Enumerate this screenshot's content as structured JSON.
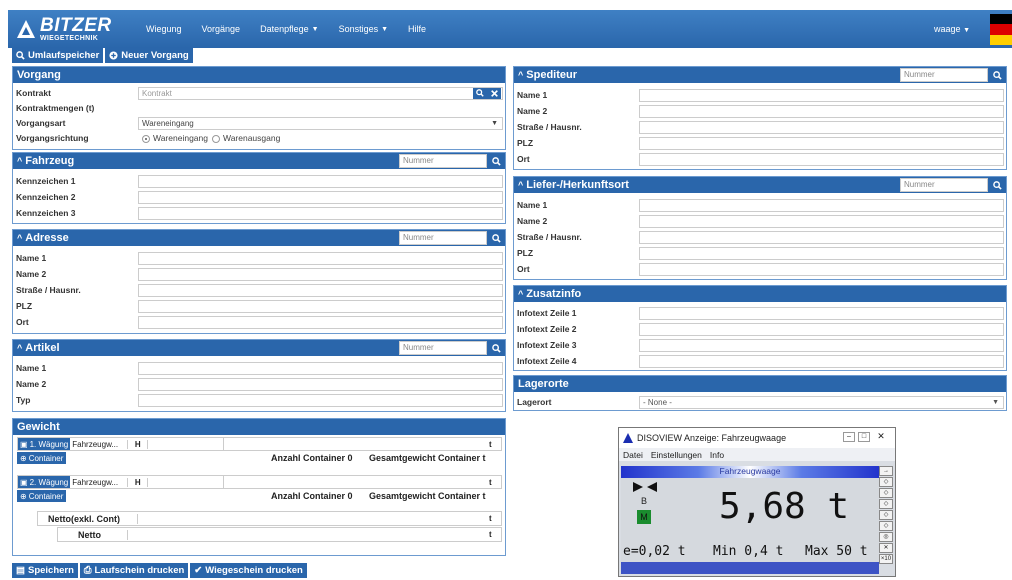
{
  "brand": {
    "name": "BITZER",
    "sub": "WIEGETECHNIK"
  },
  "nav": [
    "Wiegung",
    "Vorgänge",
    "Datenpflege",
    "Sonstiges",
    "Hilfe"
  ],
  "user": "waage",
  "toolbar": {
    "umlauf": "Umlaufspeicher",
    "neu": "Neuer Vorgang"
  },
  "vorgang": {
    "title": "Vorgang",
    "kontrakt_label": "Kontrakt",
    "kontrakt_placeholder": "Kontrakt",
    "mengen_label": "Kontraktmengen (t)",
    "art_label": "Vorgangsart",
    "art_value": "Wareneingang",
    "richtung_label": "Vorgangsrichtung",
    "richtung_opt1": "Wareneingang",
    "richtung_opt2": "Warenausgang"
  },
  "fahrzeug": {
    "title": "Fahrzeug",
    "placeholder": "Nummer",
    "fields": [
      "Kennzeichen 1",
      "Kennzeichen 2",
      "Kennzeichen 3"
    ]
  },
  "adresse": {
    "title": "Adresse",
    "placeholder": "Nummer",
    "fields": [
      "Name 1",
      "Name 2",
      "Straße / Hausnr.",
      "PLZ",
      "Ort"
    ]
  },
  "artikel": {
    "title": "Artikel",
    "placeholder": "Nummer",
    "fields": [
      "Name 1",
      "Name 2",
      "Typ"
    ]
  },
  "gewicht": {
    "title": "Gewicht",
    "w1": "1. Wägung",
    "w2": "2. Wägung",
    "scale": "Fahrzeugw...",
    "h": "H",
    "unit": "t",
    "container": "Container",
    "anzahl": "Anzahl Container 0",
    "gesamt": "Gesamtgewicht Container t",
    "netto_exkl": "Netto(exkl. Cont)",
    "netto": "Netto"
  },
  "spediteur": {
    "title": "Spediteur",
    "placeholder": "Nummer",
    "fields": [
      "Name 1",
      "Name 2",
      "Straße / Hausnr.",
      "PLZ",
      "Ort"
    ]
  },
  "liefer": {
    "title": "Liefer-/Herkunftsort",
    "placeholder": "Nummer",
    "fields": [
      "Name 1",
      "Name 2",
      "Straße / Hausnr.",
      "PLZ",
      "Ort"
    ]
  },
  "zusatz": {
    "title": "Zusatzinfo",
    "fields": [
      "Infotext Zeile 1",
      "Infotext Zeile 2",
      "Infotext Zeile 3",
      "Infotext Zeile 4"
    ]
  },
  "lager": {
    "title": "Lagerorte",
    "label": "Lagerort",
    "value": "- None -"
  },
  "bottom": {
    "save": "Speichern",
    "lauf": "Laufschein drucken",
    "wiege": "Wiegeschein drucken"
  },
  "dialog": {
    "title": "DISOVIEW Anzeige: Fahrzeugwaage",
    "menu": [
      "Datei",
      "Einstellungen",
      "Info"
    ],
    "bar": "Fahrzeugwaage",
    "b": "B",
    "m": "M",
    "value": "5,68 t",
    "e": "e=0,02 t",
    "min": "Min 0,4 t",
    "max": "Max 50 t",
    "side_last": "×10"
  }
}
